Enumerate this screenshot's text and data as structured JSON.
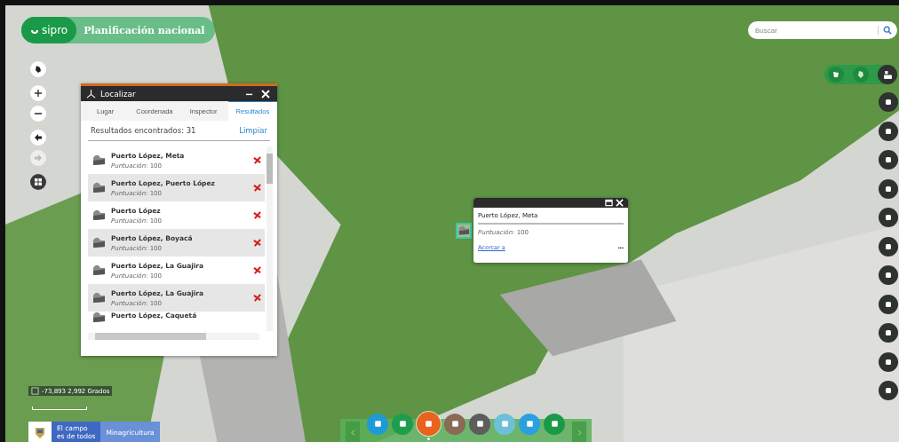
{
  "header": {
    "logo": "sipro",
    "title": "Planificación nacional"
  },
  "search": {
    "placeholder": "Buscar"
  },
  "locate_panel": {
    "title": "Localizar",
    "tabs": [
      {
        "label": "Lugar",
        "selected": false
      },
      {
        "label": "Coordenada",
        "selected": false
      },
      {
        "label": "Inspector",
        "selected": false
      },
      {
        "label": "Resultados",
        "selected": true
      }
    ],
    "summary": "Resultados encontrados: 31",
    "clear": "Limpiar",
    "results": [
      {
        "name": "Puerto López, Meta",
        "score": "*Puntuación*: 100"
      },
      {
        "name": "Puerto Lopez, Puerto López",
        "score": "*Puntuación*: 100"
      },
      {
        "name": "Puerto López",
        "score": "*Puntuación*: 100"
      },
      {
        "name": "Puerto López, Boyacá",
        "score": "*Puntuación*: 100"
      },
      {
        "name": "Puerto López, La Guajira",
        "score": "*Puntuación*: 100"
      },
      {
        "name": "Puerto López, La Guajira",
        "score": "*Puntuación*: 100"
      },
      {
        "name": "Puerto López, Caquetá"
      }
    ]
  },
  "popup": {
    "title": "Puerto López, Meta",
    "score": "*Puntuación*: 100",
    "link": "Acercar a",
    "more": "•••"
  },
  "coordinates": "-73,893 2,992 Grados",
  "footer_logo": {
    "line1": "El campo",
    "line2": "es de todos",
    "ministry": "Minagricultura"
  },
  "toolbar": [
    {
      "color": "#1e9bd7",
      "selected": false
    },
    {
      "color": "#1e9e4c",
      "selected": false
    },
    {
      "color": "#e8631e",
      "selected": true
    },
    {
      "color": "#8b6a55",
      "selected": false
    },
    {
      "color": "#5d5d5d",
      "selected": false
    },
    {
      "color": "#6cc0d8",
      "selected": false
    },
    {
      "color": "#2aa0de",
      "selected": false
    },
    {
      "color": "#1a9a47",
      "selected": false
    }
  ]
}
